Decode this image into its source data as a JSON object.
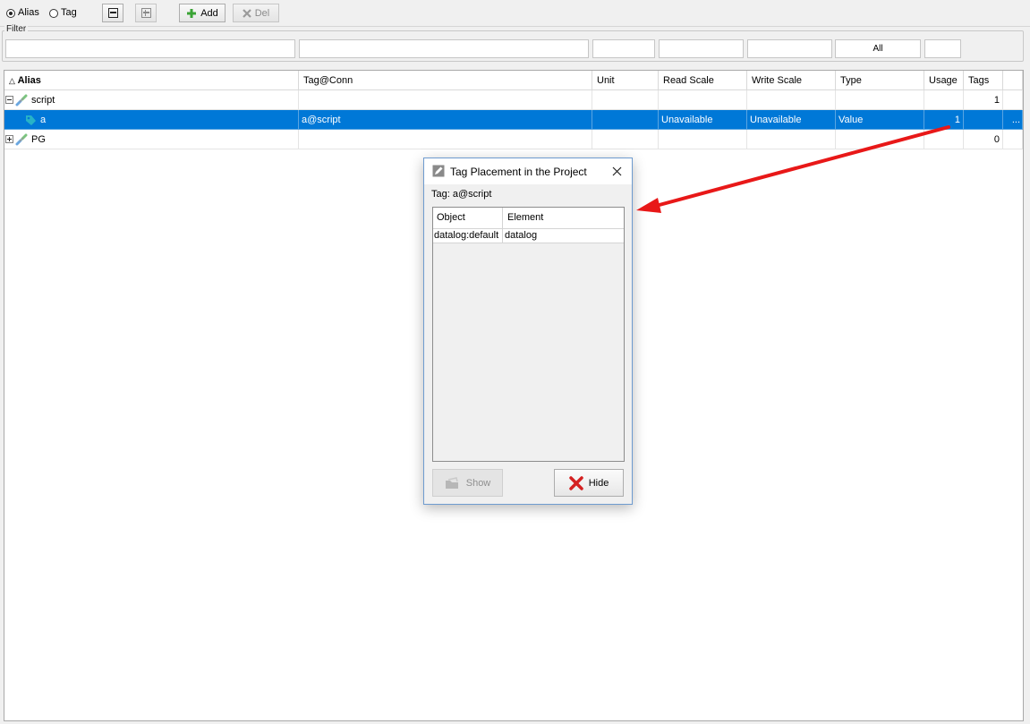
{
  "toolbar": {
    "radio_alias_label": "Alias",
    "radio_tag_label": "Tag",
    "selected_mode": "Alias",
    "add_label": "Add",
    "del_label": "Del"
  },
  "filter": {
    "legend": "Filter",
    "type_value": "All"
  },
  "table": {
    "headers": {
      "alias": "Alias",
      "tag_conn": "Tag@Conn",
      "unit": "Unit",
      "read_scale": "Read Scale",
      "write_scale": "Write Scale",
      "type": "Type",
      "usage": "Usage",
      "tags": "Tags"
    },
    "rows": [
      {
        "alias": "script",
        "tag_conn": "",
        "unit": "",
        "read_scale": "",
        "write_scale": "",
        "type": "",
        "usage": "",
        "tags": "1"
      },
      {
        "alias": "a",
        "tag_conn": "a@script",
        "unit": "",
        "read_scale": "Unavailable",
        "write_scale": "Unavailable",
        "type": "Value",
        "usage": "1",
        "tags": "",
        "more": "..."
      },
      {
        "alias": "PG",
        "tag_conn": "",
        "unit": "",
        "read_scale": "",
        "write_scale": "",
        "type": "",
        "usage": "",
        "tags": "0"
      }
    ]
  },
  "dialog": {
    "title": "Tag Placement in the Project",
    "tag_label": "Tag: a@script",
    "columns": [
      "Object",
      "Element"
    ],
    "rows": [
      {
        "object": "datalog:default",
        "element": "datalog"
      }
    ],
    "show_label": "Show",
    "hide_label": "Hide"
  },
  "colors": {
    "selection": "#0078d7",
    "annotation_arrow": "#e81818",
    "add_icon": "#3aa335",
    "hide_icon": "#d42020"
  }
}
